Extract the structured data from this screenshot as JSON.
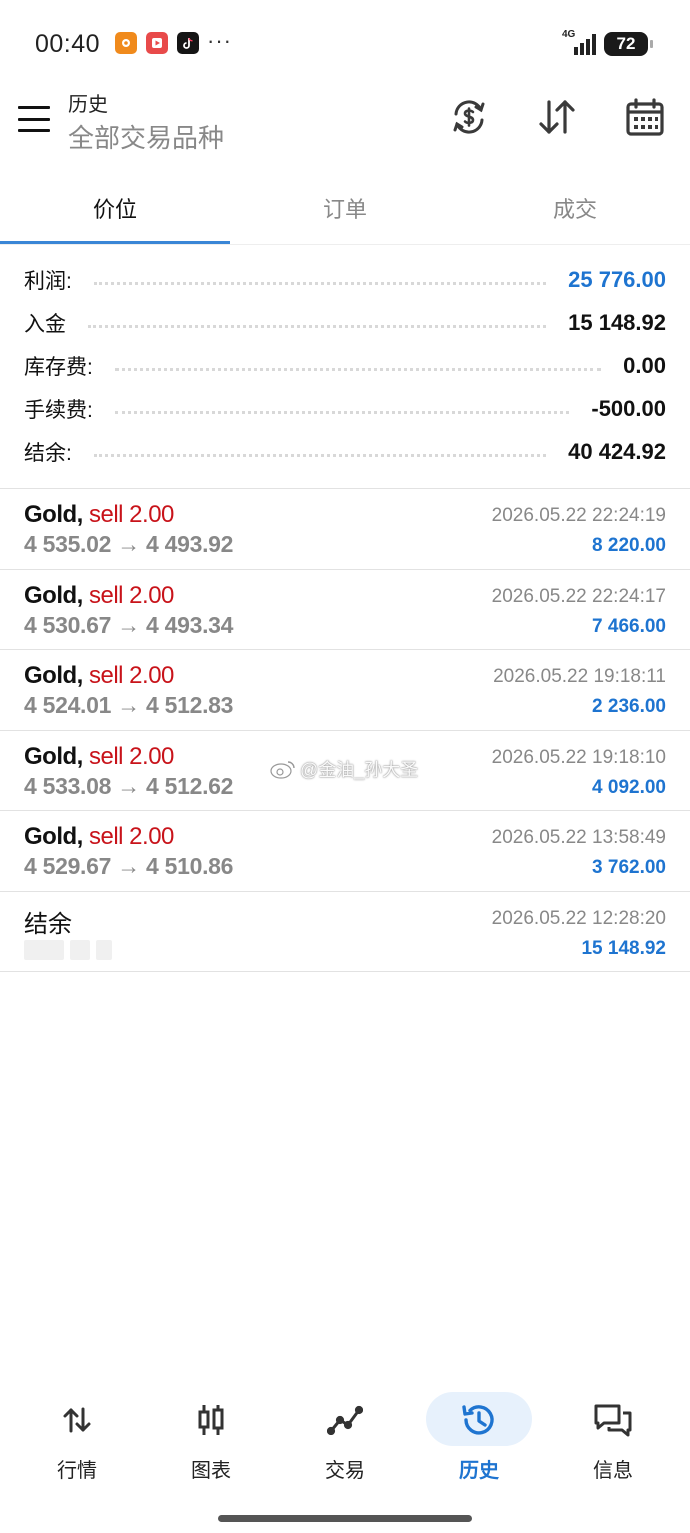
{
  "status_bar": {
    "time": "00:40",
    "more": "···",
    "network": "4G",
    "battery": "72"
  },
  "header": {
    "title": "历史",
    "subtitle": "全部交易品种",
    "icons": [
      "currency-exchange-icon",
      "sort-icon",
      "calendar-icon"
    ]
  },
  "tabs": [
    {
      "label": "价位",
      "active": true
    },
    {
      "label": "订单",
      "active": false
    },
    {
      "label": "成交",
      "active": false
    }
  ],
  "summary": [
    {
      "label": "利润:",
      "value": "25 776.00",
      "highlight": true
    },
    {
      "label": "入金",
      "value": "15 148.92",
      "highlight": false
    },
    {
      "label": "库存费:",
      "value": "0.00",
      "highlight": false
    },
    {
      "label": "手续费:",
      "value": "-500.00",
      "highlight": false
    },
    {
      "label": "结余:",
      "value": "40 424.92",
      "highlight": false
    }
  ],
  "deals": [
    {
      "symbol": "Gold,",
      "side": "sell 2.00",
      "prices": "4 535.02 → 4 493.92",
      "time": "2026.05.22 22:24:19",
      "profit": "8 220.00"
    },
    {
      "symbol": "Gold,",
      "side": "sell 2.00",
      "prices": "4 530.67 → 4 493.34",
      "time": "2026.05.22 22:24:17",
      "profit": "7 466.00"
    },
    {
      "symbol": "Gold,",
      "side": "sell 2.00",
      "prices": "4 524.01 → 4 512.83",
      "time": "2026.05.22 19:18:11",
      "profit": "2 236.00"
    },
    {
      "symbol": "Gold,",
      "side": "sell 2.00",
      "prices": "4 533.08 → 4 512.62",
      "time": "2026.05.22 19:18:10",
      "profit": "4 092.00"
    },
    {
      "symbol": "Gold,",
      "side": "sell 2.00",
      "prices": "4 529.67 → 4 510.86",
      "time": "2026.05.22 13:58:49",
      "profit": "3 762.00"
    }
  ],
  "balance_entry": {
    "label": "结余",
    "time": "2026.05.22 12:28:20",
    "amount": "15 148.92"
  },
  "watermark": "@金油_孙大圣",
  "bottom_nav": [
    {
      "label": "行情",
      "icon": "quotes-icon",
      "active": false
    },
    {
      "label": "图表",
      "icon": "chart-icon",
      "active": false
    },
    {
      "label": "交易",
      "icon": "trade-icon",
      "active": false
    },
    {
      "label": "历史",
      "icon": "history-icon",
      "active": true
    },
    {
      "label": "信息",
      "icon": "messages-icon",
      "active": false
    }
  ],
  "colors": {
    "accent": "#1e74d0",
    "sell": "#c8131a",
    "muted": "#888888",
    "active_pill": "#e7f1fc"
  }
}
